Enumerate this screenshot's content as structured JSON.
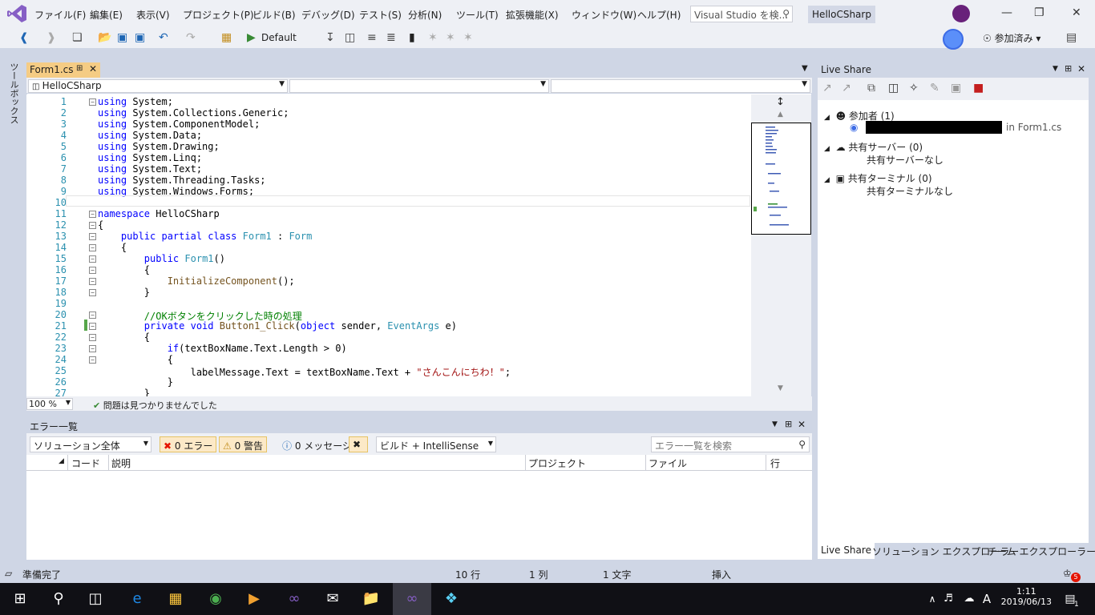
{
  "menu": [
    "ファイル(F)",
    "編集(E)",
    "表示(V)",
    "プロジェクト(P)",
    "ビルド(B)",
    "デバッグ(D)",
    "テスト(S)",
    "分析(N)",
    "ツール(T)",
    "拡張機能(X)",
    "ウィンドウ(W)",
    "ヘルプ(H)"
  ],
  "search": {
    "placeholder": "Visual Studio を検..."
  },
  "solution_name": "HelloCSharp",
  "toolbar": {
    "config": "Default",
    "share_status": "参加済み"
  },
  "sidebar": {
    "toolbox": "ツールボックス"
  },
  "editor": {
    "tab": "Form1.cs",
    "nav": [
      "HelloCSharp",
      "",
      ""
    ],
    "lines": [
      {
        "n": "1",
        "t": [
          [
            "kw",
            "using"
          ],
          [
            "tx",
            " System;"
          ]
        ]
      },
      {
        "n": "2",
        "t": [
          [
            "kw",
            "using"
          ],
          [
            "tx",
            " System.Collections.Generic;"
          ]
        ]
      },
      {
        "n": "3",
        "t": [
          [
            "kw",
            "using"
          ],
          [
            "tx",
            " System.ComponentModel;"
          ]
        ]
      },
      {
        "n": "4",
        "t": [
          [
            "kw",
            "using"
          ],
          [
            "tx",
            " System.Data;"
          ]
        ]
      },
      {
        "n": "5",
        "t": [
          [
            "kw",
            "using"
          ],
          [
            "tx",
            " System.Drawing;"
          ]
        ]
      },
      {
        "n": "6",
        "t": [
          [
            "kw",
            "using"
          ],
          [
            "tx",
            " System.Linq;"
          ]
        ]
      },
      {
        "n": "7",
        "t": [
          [
            "kw",
            "using"
          ],
          [
            "tx",
            " System.Text;"
          ]
        ]
      },
      {
        "n": "8",
        "t": [
          [
            "kw",
            "using"
          ],
          [
            "tx",
            " System.Threading.Tasks;"
          ]
        ]
      },
      {
        "n": "9",
        "t": [
          [
            "kw",
            "using"
          ],
          [
            "tx",
            " System.Windows.Forms;"
          ]
        ]
      },
      {
        "n": "10",
        "t": []
      },
      {
        "n": "11",
        "t": [
          [
            "kw",
            "namespace"
          ],
          [
            "tx",
            " HelloCSharp"
          ]
        ]
      },
      {
        "n": "12",
        "t": [
          [
            "tx",
            "{"
          ]
        ]
      },
      {
        "n": "13",
        "t": [
          [
            "tx",
            "    "
          ],
          [
            "kw",
            "public partial class"
          ],
          [
            "tx",
            " "
          ],
          [
            "ty",
            "Form1"
          ],
          [
            "tx",
            " : "
          ],
          [
            "ty",
            "Form"
          ]
        ]
      },
      {
        "n": "14",
        "t": [
          [
            "tx",
            "    {"
          ]
        ]
      },
      {
        "n": "15",
        "t": [
          [
            "tx",
            "        "
          ],
          [
            "kw",
            "public"
          ],
          [
            "tx",
            " "
          ],
          [
            "ty",
            "Form1"
          ],
          [
            "tx",
            "()"
          ]
        ]
      },
      {
        "n": "16",
        "t": [
          [
            "tx",
            "        {"
          ]
        ]
      },
      {
        "n": "17",
        "t": [
          [
            "tx",
            "            "
          ],
          [
            "mt",
            "InitializeComponent"
          ],
          [
            "tx",
            "();"
          ]
        ]
      },
      {
        "n": "18",
        "t": [
          [
            "tx",
            "        }"
          ]
        ]
      },
      {
        "n": "19",
        "t": []
      },
      {
        "n": "20",
        "t": [
          [
            "tx",
            "        "
          ],
          [
            "cm",
            "//OKボタンをクリックした時の処理"
          ]
        ]
      },
      {
        "n": "21",
        "t": [
          [
            "tx",
            "        "
          ],
          [
            "kw",
            "private void"
          ],
          [
            "tx",
            " "
          ],
          [
            "mt",
            "Button1_Click"
          ],
          [
            "tx",
            "("
          ],
          [
            "kw",
            "object"
          ],
          [
            "tx",
            " sender, "
          ],
          [
            "ty",
            "EventArgs"
          ],
          [
            "tx",
            " e)"
          ]
        ]
      },
      {
        "n": "22",
        "t": [
          [
            "tx",
            "        {"
          ]
        ]
      },
      {
        "n": "23",
        "t": [
          [
            "tx",
            "            "
          ],
          [
            "kw",
            "if"
          ],
          [
            "tx",
            "(textBoxName.Text.Length > 0)"
          ]
        ]
      },
      {
        "n": "24",
        "t": [
          [
            "tx",
            "            {"
          ]
        ]
      },
      {
        "n": "25",
        "t": [
          [
            "tx",
            "                labelMessage.Text = textBoxName.Text + "
          ],
          [
            "st",
            "\"さんこんにちわ！\""
          ],
          [
            "tx",
            ";"
          ]
        ]
      },
      {
        "n": "26",
        "t": [
          [
            "tx",
            "            }"
          ]
        ]
      },
      {
        "n": "27",
        "t": [
          [
            "tx",
            "        }"
          ]
        ]
      }
    ],
    "zoom": "100 %",
    "issues": "問題は見つかりませんでした"
  },
  "error_list": {
    "title": "エラー一覧",
    "scope": "ソリューション全体",
    "errors": "0 エラー",
    "warnings": "0 警告",
    "messages": "0 メッセージ",
    "source": "ビルド + IntelliSense",
    "search_placeholder": "エラー一覧を検索",
    "columns": [
      "コード",
      "説明",
      "プロジェクト",
      "ファイル",
      "行"
    ]
  },
  "live_share": {
    "title": "Live Share",
    "participants": "参加者 (1)",
    "participant_file": "in Form1.cs",
    "servers": "共有サーバー (0)",
    "servers_none": "共有サーバーなし",
    "terminals": "共有ターミナル (0)",
    "terminals_none": "共有ターミナルなし",
    "tabs": [
      "Live Share",
      "ソリューション エクスプローラー",
      "チーム エクスプローラー"
    ]
  },
  "status": {
    "ready": "準備完了",
    "line": "10 行",
    "col": "1 列",
    "char": "1 文字",
    "mode": "挿入",
    "notifications": "5"
  },
  "taskbar": {
    "time": "1:11",
    "date": "2019/06/13",
    "ime": "A",
    "notif_count": "1"
  },
  "colors": {
    "accent": "#68217a",
    "tab_active": "#f5cc84",
    "chrome": "#cfd6e5"
  }
}
